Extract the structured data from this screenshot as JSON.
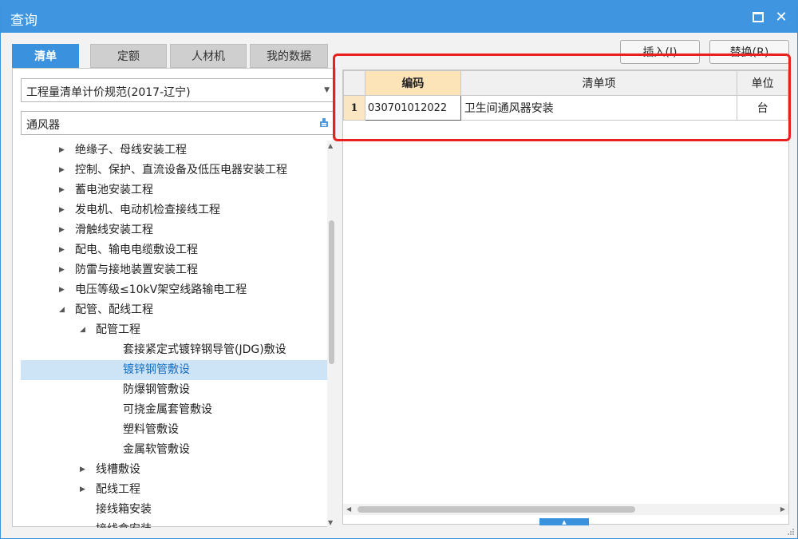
{
  "window": {
    "title": "查询",
    "accent": "#3f95e0",
    "highlight_color": "#e8201e"
  },
  "tabs": [
    {
      "label": "清单",
      "active": true
    },
    {
      "label": "定额",
      "active": false
    },
    {
      "label": "人材机",
      "active": false
    },
    {
      "label": "我的数据",
      "active": false
    }
  ],
  "spec_select": {
    "value": "工程量清单计价规范(2017-辽宁)"
  },
  "search": {
    "value": "通风器"
  },
  "tree": [
    {
      "label": "绝缘子、母线安装工程",
      "level": 1,
      "expanded": false,
      "has_children": true,
      "selected": false
    },
    {
      "label": "控制、保护、直流设备及低压电器安装工程",
      "level": 1,
      "expanded": false,
      "has_children": true,
      "selected": false
    },
    {
      "label": "蓄电池安装工程",
      "level": 1,
      "expanded": false,
      "has_children": true,
      "selected": false
    },
    {
      "label": "发电机、电动机检查接线工程",
      "level": 1,
      "expanded": false,
      "has_children": true,
      "selected": false
    },
    {
      "label": "滑触线安装工程",
      "level": 1,
      "expanded": false,
      "has_children": true,
      "selected": false
    },
    {
      "label": "配电、输电电缆敷设工程",
      "level": 1,
      "expanded": false,
      "has_children": true,
      "selected": false
    },
    {
      "label": "防雷与接地装置安装工程",
      "level": 1,
      "expanded": false,
      "has_children": true,
      "selected": false
    },
    {
      "label": "电压等级≤10kV架空线路输电工程",
      "level": 1,
      "expanded": false,
      "has_children": true,
      "selected": false
    },
    {
      "label": "配管、配线工程",
      "level": 1,
      "expanded": true,
      "has_children": true,
      "selected": false
    },
    {
      "label": "配管工程",
      "level": 2,
      "expanded": true,
      "has_children": true,
      "selected": false
    },
    {
      "label": "套接紧定式镀锌钢导管(JDG)敷设",
      "level": 3,
      "expanded": false,
      "has_children": false,
      "selected": false
    },
    {
      "label": "镀锌钢管敷设",
      "level": 3,
      "expanded": false,
      "has_children": false,
      "selected": true
    },
    {
      "label": "防爆钢管敷设",
      "level": 3,
      "expanded": false,
      "has_children": false,
      "selected": false
    },
    {
      "label": "可挠金属套管敷设",
      "level": 3,
      "expanded": false,
      "has_children": false,
      "selected": false
    },
    {
      "label": "塑料管敷设",
      "level": 3,
      "expanded": false,
      "has_children": false,
      "selected": false
    },
    {
      "label": "金属软管敷设",
      "level": 3,
      "expanded": false,
      "has_children": false,
      "selected": false
    },
    {
      "label": "线槽敷设",
      "level": 2,
      "expanded": false,
      "has_children": true,
      "selected": false
    },
    {
      "label": "配线工程",
      "level": 2,
      "expanded": false,
      "has_children": true,
      "selected": false
    },
    {
      "label": "接线箱安装",
      "level": 2,
      "expanded": false,
      "has_children": false,
      "selected": false
    },
    {
      "label": "接线盒安装",
      "level": 2,
      "expanded": false,
      "has_children": false,
      "selected": false
    }
  ],
  "buttons": {
    "insert": "插入(I)",
    "replace": "替换(R)"
  },
  "grid": {
    "headers": {
      "code": "编码",
      "item": "清单项",
      "unit": "单位"
    },
    "rows": [
      {
        "num": "1",
        "code": "030701012022",
        "item": "卫生间通风器安装",
        "unit": "台"
      }
    ]
  }
}
